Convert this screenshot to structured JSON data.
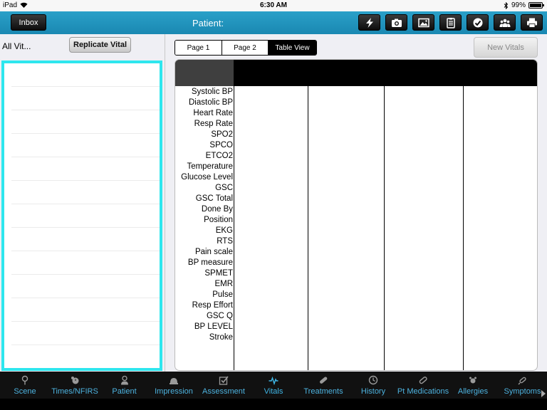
{
  "status_bar": {
    "carrier": "iPad",
    "time": "6:30 AM",
    "battery": "99%"
  },
  "nav": {
    "inbox_label": "Inbox",
    "title": "Patient:",
    "actions": [
      "lightning-icon",
      "camera-icon",
      "gallery-icon",
      "clipboard-icon",
      "check-icon",
      "people-icon",
      "printer-icon"
    ]
  },
  "left": {
    "header_label": "All Vit...",
    "replicate_label": "Replicate Vital",
    "accent_color": "#2ee6ee"
  },
  "right": {
    "segments": [
      {
        "label": "Page 1",
        "active": false
      },
      {
        "label": "Page 2",
        "active": false
      },
      {
        "label": "Table View",
        "active": true
      }
    ],
    "new_vitals_label": "New Vitals",
    "row_labels": [
      "Systolic BP",
      "Diastolic BP",
      "Heart Rate",
      "Resp Rate",
      "SPO2",
      "SPCO",
      "ETCO2",
      "Temperature",
      "Glucose Level",
      "GSC",
      "GSC Total",
      "Done By",
      "Position",
      "EKG",
      "RTS",
      "Pain scale",
      "BP measure",
      "SPMET",
      "EMR",
      "Pulse",
      "Resp Effort",
      "GSC Q",
      "BP LEVEL",
      "Stroke"
    ]
  },
  "tabs": [
    {
      "label": "Scene",
      "icon": "pin-icon",
      "active": false
    },
    {
      "label": "Times/NFIRS",
      "icon": "stopwatch-icon",
      "active": false
    },
    {
      "label": "Patient",
      "icon": "person-icon",
      "active": false
    },
    {
      "label": "Impression",
      "icon": "hat-icon",
      "active": false
    },
    {
      "label": "Assessment",
      "icon": "checkbox-icon",
      "active": false
    },
    {
      "label": "Vitals",
      "icon": "pulse-icon",
      "active": true
    },
    {
      "label": "Treatments",
      "icon": "bandage-icon",
      "active": false
    },
    {
      "label": "History",
      "icon": "clock-icon",
      "active": false
    },
    {
      "label": "Pt Medications",
      "icon": "pill-icon",
      "active": false
    },
    {
      "label": "Allergies",
      "icon": "allergen-icon",
      "active": false
    },
    {
      "label": "Symptoms",
      "icon": "syringe-icon",
      "active": false
    }
  ]
}
